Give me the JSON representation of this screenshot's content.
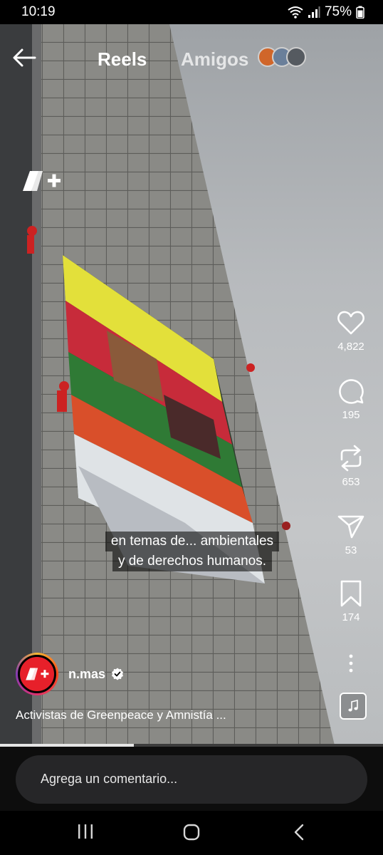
{
  "status_bar": {
    "time": "10:19",
    "battery": "75%"
  },
  "header": {
    "tab_reels": "Reels",
    "tab_friends": "Amigos"
  },
  "video": {
    "caption_line1": "en temas de... ambientales",
    "caption_line2": "y de derechos humanos."
  },
  "actions": {
    "likes": "4,822",
    "comments": "195",
    "reposts": "653",
    "shares": "53",
    "saves": "174"
  },
  "post": {
    "author": "n.mas",
    "description": "Activistas de Greenpeace y Amnistía ...",
    "progress": 0.35
  },
  "comment": {
    "placeholder": "Agrega un comentario..."
  },
  "colors": {
    "brand": "#e7202a",
    "background": "#000000"
  }
}
